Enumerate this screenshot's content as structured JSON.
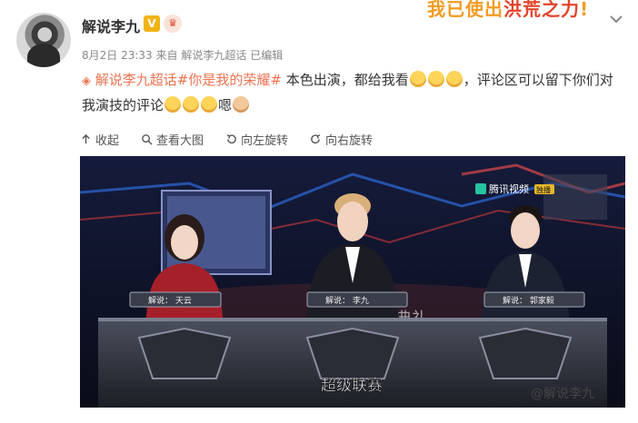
{
  "author": {
    "name": "解说李九",
    "badge": "V",
    "badge_color": "#f1b317"
  },
  "promo": {
    "text_before": "我已使出",
    "highlight": "洪荒之力",
    "text_after": "!"
  },
  "meta": {
    "date": "8月2日",
    "time": "23:33",
    "source": "来自 解说李九超话",
    "edited": "已编辑"
  },
  "post": {
    "topic": "解说李九超话#你是我的荣耀#",
    "text_part1": " 本色出演，都给我看",
    "text_part2": "，评论区可以留下你们对我演技的评论",
    "text_part3": "嗯"
  },
  "toolbar": {
    "collapse": "收起",
    "view_large": "查看大图",
    "rotate_left": "向左旋转",
    "rotate_right": "向右旋转"
  },
  "video": {
    "platform": "腾讯视频",
    "platform_tag": "独播",
    "nameplates": [
      "解说： 天云",
      "解说： 李九",
      "解说： 郭家毅"
    ],
    "banner": "年度颁奖典礼",
    "subtitle": "超级联赛"
  },
  "watermark": "@解说李九",
  "colors": {
    "topic": "#eb7350",
    "meta": "#888888",
    "accent": "#f39b22"
  }
}
